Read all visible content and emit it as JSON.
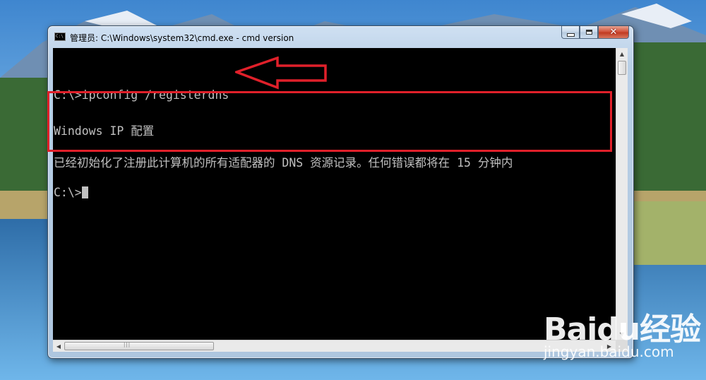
{
  "window": {
    "title": "管理员: C:\\Windows\\system32\\cmd.exe - cmd  version",
    "icon": "cmd-icon"
  },
  "console": {
    "lines": [
      "C:\\>ipconfig /registerdns",
      "Windows IP 配置",
      "已经初始化了注册此计算机的所有适配器的 DNS 资源记录。任何错误都将在 15 分钟内",
      "C:\\>"
    ]
  },
  "annotation": {
    "highlight_color": "#e0202a",
    "arrow_color": "#e0202a"
  },
  "watermark": {
    "logo": "Baidu经验",
    "url": "jingyan.baidu.com"
  }
}
